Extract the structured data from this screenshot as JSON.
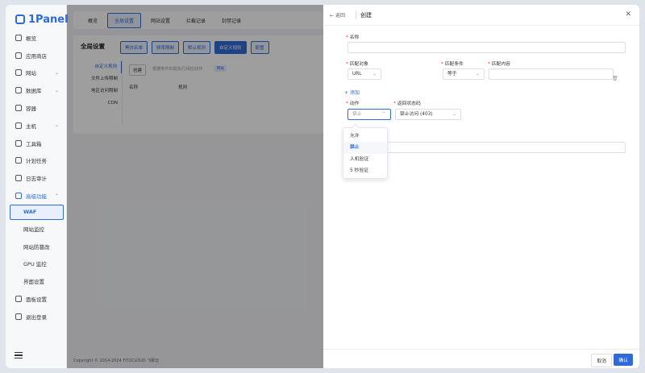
{
  "app": {
    "logo": "1Panel"
  },
  "sidebar": {
    "items": [
      {
        "label": "概览",
        "icon": "home-icon"
      },
      {
        "label": "应用商店",
        "icon": "store-icon"
      },
      {
        "label": "网站",
        "icon": "globe-icon",
        "expandable": true
      },
      {
        "label": "数据库",
        "icon": "database-icon",
        "expandable": true
      },
      {
        "label": "容器",
        "icon": "container-icon"
      },
      {
        "label": "主机",
        "icon": "host-icon",
        "expandable": true
      },
      {
        "label": "工具箱",
        "icon": "toolbox-icon"
      },
      {
        "label": "计划任务",
        "icon": "clock-icon"
      },
      {
        "label": "日志审计",
        "icon": "log-icon"
      },
      {
        "label": "高级功能",
        "icon": "diamond-icon",
        "expandable": true
      },
      {
        "label": "WAF"
      },
      {
        "label": "网站监控"
      },
      {
        "label": "网站防篡改"
      },
      {
        "label": "GPU 监控"
      },
      {
        "label": "界面设置"
      },
      {
        "label": "面板设置",
        "icon": "settings-icon"
      },
      {
        "label": "退出登录",
        "icon": "logout-icon"
      }
    ]
  },
  "topbar": {
    "tabs": [
      "概览",
      "全局设置",
      "网站设置",
      "拦截记录",
      "封禁记录"
    ],
    "active": 1
  },
  "card": {
    "title": "全局设置",
    "buttons": [
      "黑白名单",
      "频率限制",
      "默认规则",
      "自定义规则",
      "配置"
    ],
    "left_menu": [
      "自定义规则",
      "文件上传限制",
      "地区访问限制",
      "CDN"
    ],
    "create_label": "创建",
    "hint": "根据条件匹配执行相应动作",
    "hint_tag": "网站",
    "col_name": "名称",
    "col_rule": "规则"
  },
  "footer": {
    "text": "Copyright © 2014-2024 FIT2CLOUD 飞致云"
  },
  "drawer": {
    "back_label": "返回",
    "title": "创建",
    "name_label": "名称",
    "match_object_label": "匹配对象",
    "match_object_value": "URL",
    "match_cond_label": "匹配条件",
    "match_cond_value": "等于",
    "match_content_label": "匹配内容",
    "add_label": "添加",
    "action_label": "动作",
    "action_placeholder": "禁止",
    "status_label": "返回状态码",
    "status_value": "禁止访问 (403)",
    "action_options": [
      "允许",
      "禁止",
      "人机验证",
      "5 秒验证"
    ],
    "selected_option": 1,
    "cancel_label": "取消",
    "confirm_label": "确认"
  }
}
